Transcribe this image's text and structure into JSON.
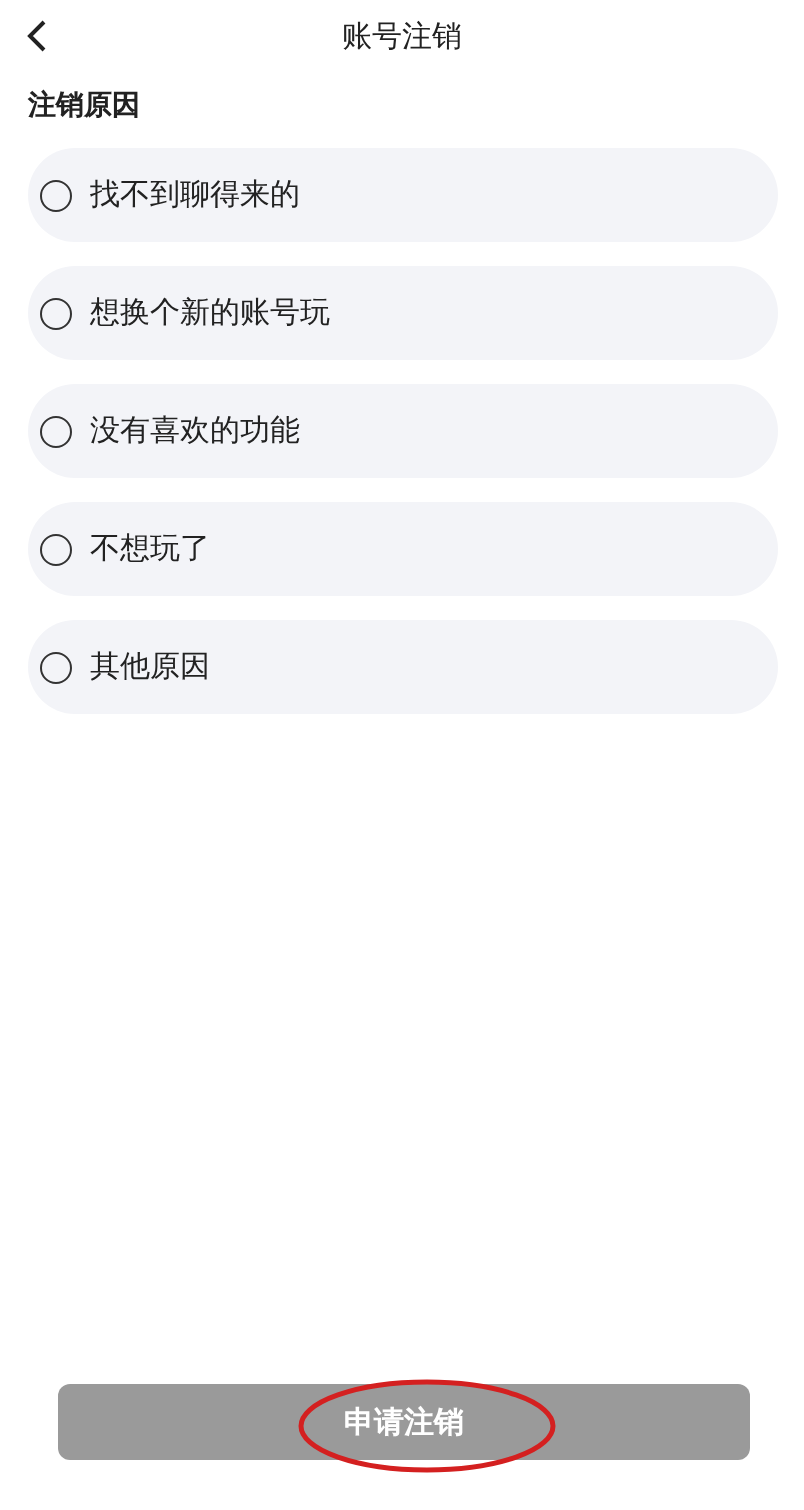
{
  "header": {
    "title": "账号注销"
  },
  "section": {
    "title": "注销原因"
  },
  "reasons": [
    {
      "label": "找不到聊得来的",
      "selected": false
    },
    {
      "label": "想换个新的账号玩",
      "selected": false
    },
    {
      "label": "没有喜欢的功能",
      "selected": false
    },
    {
      "label": "不想玩了",
      "selected": false
    },
    {
      "label": "其他原因",
      "selected": false
    }
  ],
  "submit": {
    "label": "申请注销",
    "disabled": true
  }
}
